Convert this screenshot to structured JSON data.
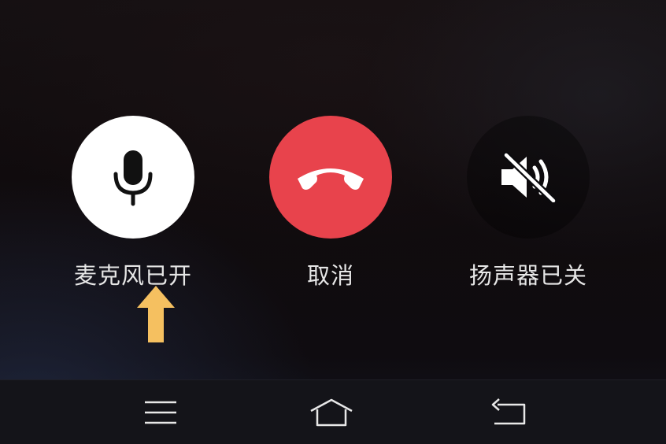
{
  "call_controls": {
    "microphone": {
      "label": "麦克风已开",
      "icon": "microphone-icon",
      "state": "on",
      "button_color": "#ffffff"
    },
    "cancel": {
      "label": "取消",
      "icon": "hang-up-icon",
      "button_color": "#e8434c"
    },
    "speaker": {
      "label": "扬声器已关",
      "icon": "speaker-muted-icon",
      "state": "off"
    },
    "hint": {
      "icon": "arrow-up-icon",
      "color": "#f5c060"
    }
  },
  "navigation_bar": {
    "items": [
      {
        "icon": "menu-icon"
      },
      {
        "icon": "home-icon"
      },
      {
        "icon": "back-icon"
      }
    ]
  }
}
